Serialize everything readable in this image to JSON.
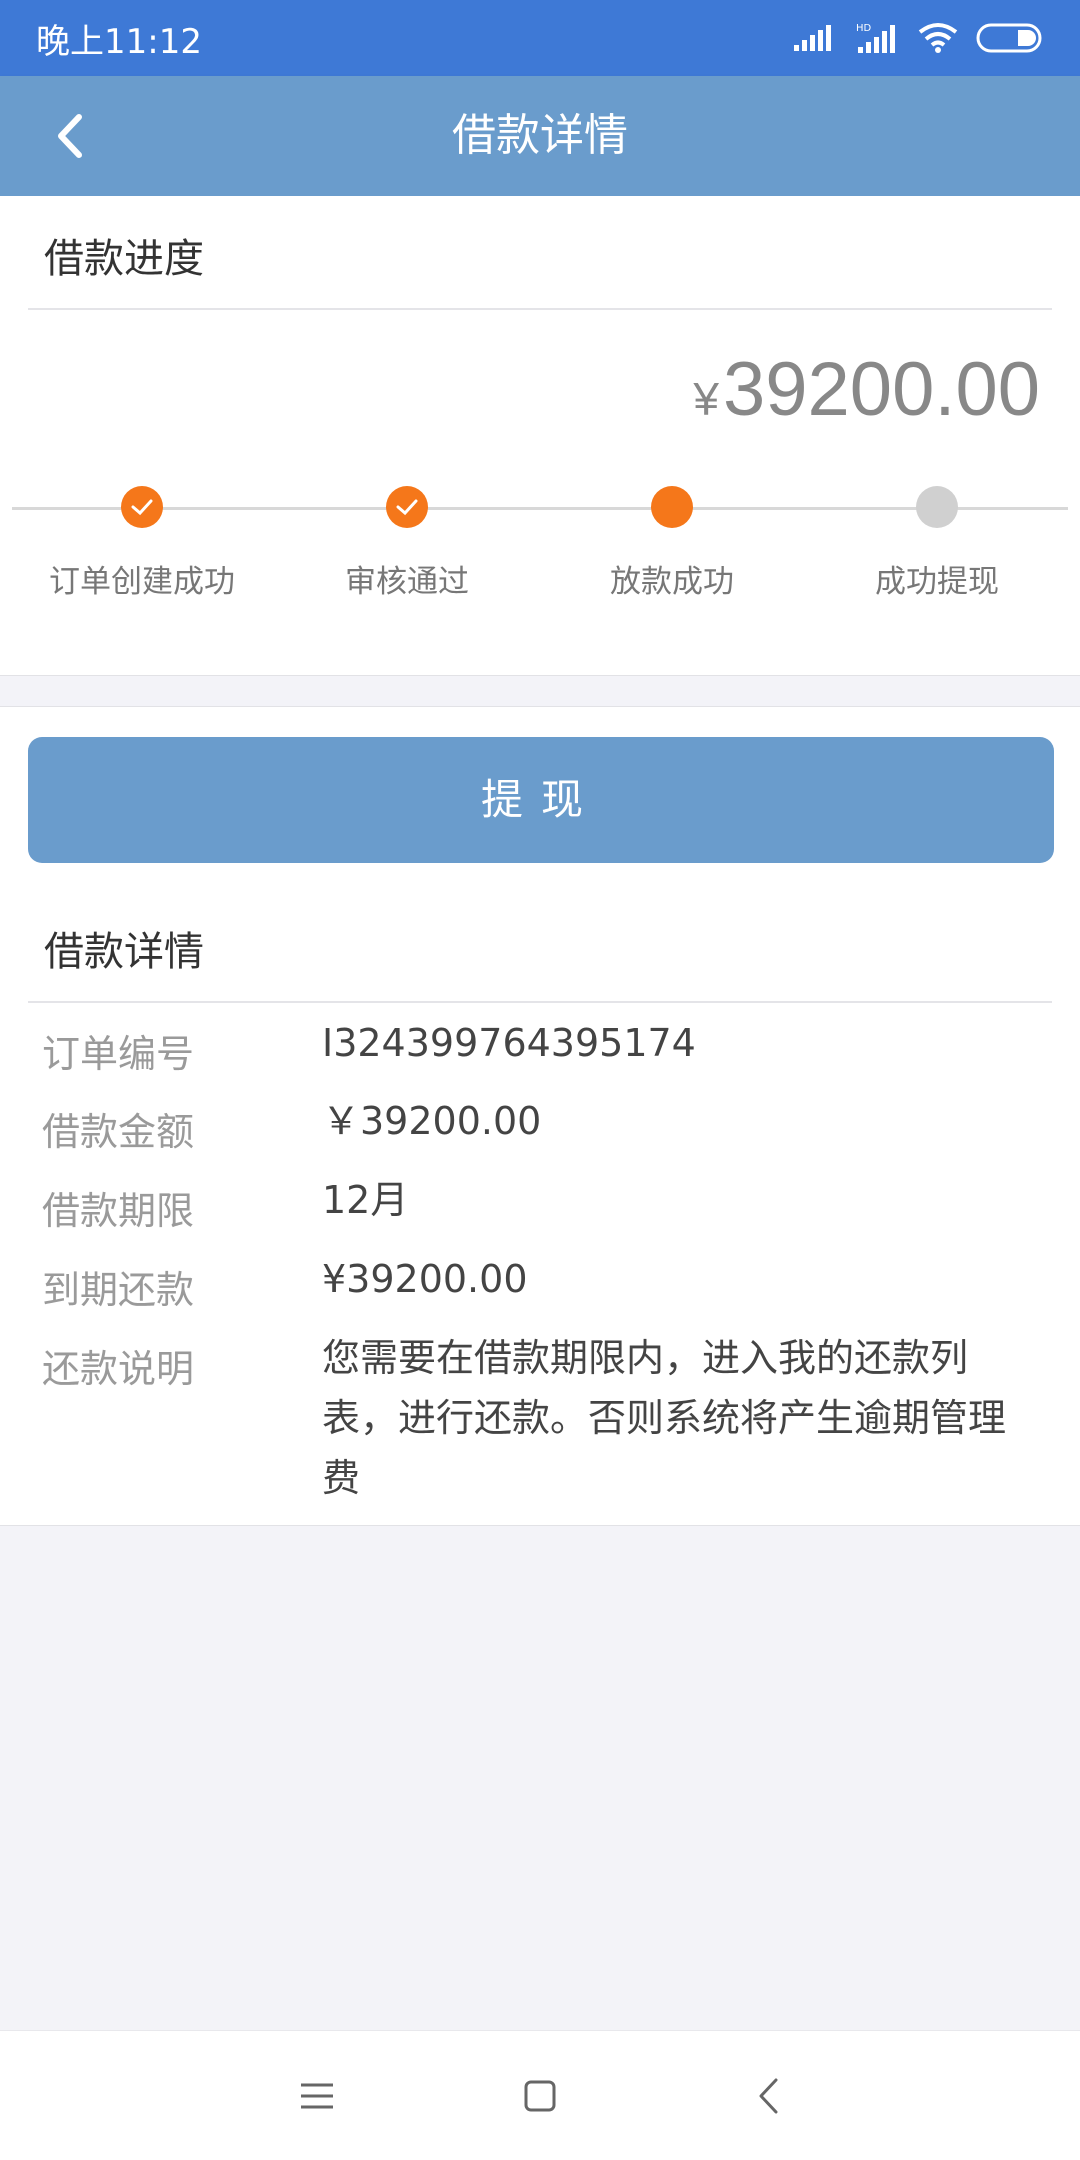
{
  "status_bar": {
    "time": "晚上11:12"
  },
  "header": {
    "title": "借款详情"
  },
  "progress": {
    "section_title": "借款进度",
    "amount_symbol": "¥",
    "amount": "39200.00",
    "steps": [
      {
        "label": "订单创建成功",
        "state": "done"
      },
      {
        "label": "审核通过",
        "state": "done"
      },
      {
        "label": "放款成功",
        "state": "active"
      },
      {
        "label": "成功提现",
        "state": "pending"
      }
    ]
  },
  "withdraw_button": {
    "label": "提现"
  },
  "details": {
    "section_title": "借款详情",
    "rows": [
      {
        "key": "订单编号",
        "value": "I324399764395174"
      },
      {
        "key": "借款金额",
        "value": "￥39200.00"
      },
      {
        "key": "借款期限",
        "value": "12月"
      },
      {
        "key": "到期还款",
        "value": "¥39200.00"
      },
      {
        "key": "还款说明",
        "value": "您需要在借款期限内，进入我的还款列表，进行还款。否则系统将产生逾期管理费"
      }
    ]
  },
  "colors": {
    "status_bar": "#3e79d6",
    "nav_bar": "#6a9ccc",
    "step_active": "#f5771a",
    "step_pending": "#d0d0d0"
  }
}
